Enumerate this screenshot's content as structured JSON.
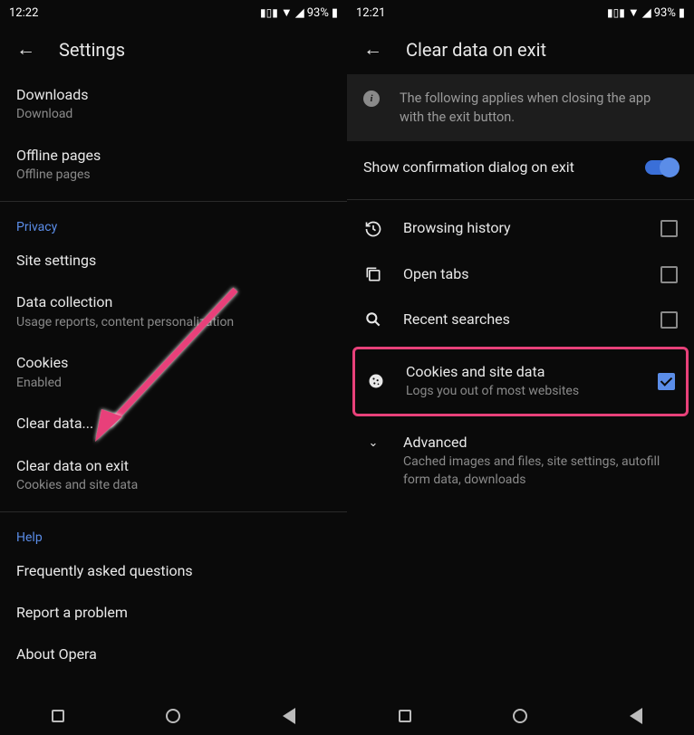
{
  "left": {
    "status": {
      "time": "12:22",
      "battery": "93%"
    },
    "title": "Settings",
    "items": {
      "downloads": {
        "title": "Downloads",
        "sub": "Download"
      },
      "offline": {
        "title": "Offline pages",
        "sub": "Offline pages"
      }
    },
    "privacy": {
      "header": "Privacy",
      "site_settings": "Site settings",
      "data_collection": {
        "title": "Data collection",
        "sub": "Usage reports, content personalization"
      },
      "cookies": {
        "title": "Cookies",
        "sub": "Enabled"
      },
      "clear_data": "Clear data...",
      "clear_on_exit": {
        "title": "Clear data on exit",
        "sub": "Cookies and site data"
      }
    },
    "help": {
      "header": "Help",
      "faq": "Frequently asked questions",
      "report": "Report a problem",
      "about": "About Opera"
    }
  },
  "right": {
    "status": {
      "time": "12:21",
      "battery": "93%"
    },
    "title": "Clear data on exit",
    "info": "The following applies when closing the app with the exit button.",
    "toggle_label": "Show confirmation dialog on exit",
    "rows": {
      "history": "Browsing history",
      "tabs": "Open tabs",
      "searches": "Recent searches",
      "cookies": {
        "title": "Cookies and site data",
        "sub": "Logs you out of most websites"
      },
      "advanced": {
        "title": "Advanced",
        "sub": "Cached images and files, site settings, autofill form data, downloads"
      }
    }
  }
}
